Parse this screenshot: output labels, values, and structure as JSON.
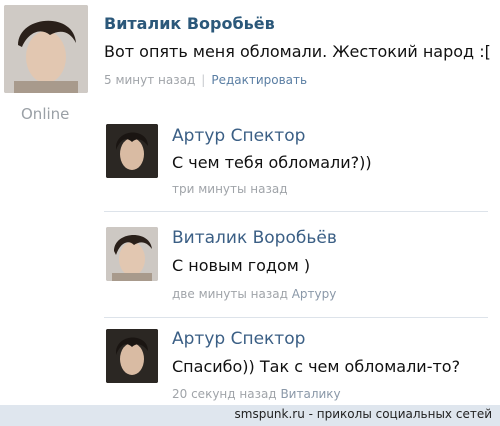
{
  "main_post": {
    "author": "Виталик Воробьёв",
    "text": "Вот опять меня обломали. Жестокий народ :[",
    "time": "5 минут назад",
    "separator": "|",
    "edit_link": "Редактировать",
    "status": "Online"
  },
  "comments": [
    {
      "author": "Артур Спектор",
      "text": "С чем тебя обломали?))",
      "time": "три минуты назад",
      "reply_to": ""
    },
    {
      "author": "Виталик Воробьёв",
      "text": "С новым годом )",
      "time": "две минуты назад",
      "reply_to": "Артуру"
    },
    {
      "author": "Артур Спектор",
      "text": "Спасибо)) Так с чем обломали-то?",
      "time": "20 секунд назад",
      "reply_to": "Виталику"
    }
  ],
  "footer": {
    "watermark": "smspunk.ru - приколы социальных сетей"
  }
}
